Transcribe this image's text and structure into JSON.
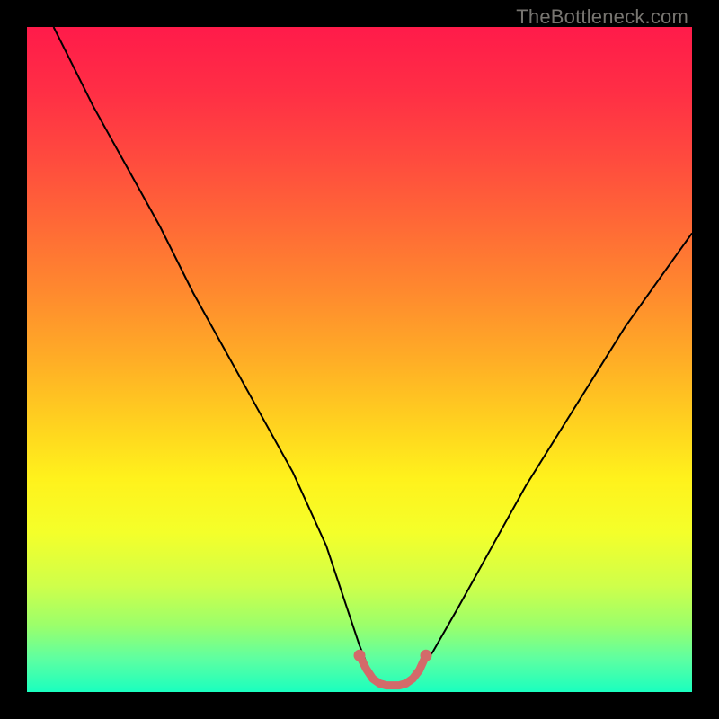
{
  "watermark": "TheBottleneck.com",
  "chart_data": {
    "type": "line",
    "title": "",
    "xlabel": "",
    "ylabel": "",
    "xlim": [
      0,
      100
    ],
    "ylim": [
      0,
      100
    ],
    "grid": false,
    "series": [
      {
        "name": "bottleneck-curve",
        "color": "#000000",
        "x": [
          4,
          10,
          15,
          20,
          25,
          30,
          35,
          40,
          45,
          48,
          50,
          52,
          54,
          56,
          58,
          61,
          65,
          70,
          75,
          80,
          85,
          90,
          95,
          100
        ],
        "y": [
          100,
          88,
          79,
          70,
          60,
          51,
          42,
          33,
          22,
          13,
          7,
          2,
          1,
          1,
          2,
          6,
          13,
          22,
          31,
          39,
          47,
          55,
          62,
          69
        ]
      },
      {
        "name": "optimal-segment",
        "color": "#d36a6a",
        "x": [
          50,
          51,
          52,
          53,
          54,
          55,
          56,
          57,
          58,
          59,
          60
        ],
        "y": [
          5.5,
          3.5,
          2.0,
          1.3,
          1.0,
          1.0,
          1.0,
          1.3,
          2.0,
          3.3,
          5.5
        ]
      }
    ],
    "gradient_stops": [
      {
        "offset": 0.0,
        "color": "#ff1b4a"
      },
      {
        "offset": 0.1,
        "color": "#ff2f45"
      },
      {
        "offset": 0.2,
        "color": "#ff4b3e"
      },
      {
        "offset": 0.3,
        "color": "#ff6a36"
      },
      {
        "offset": 0.4,
        "color": "#ff8a2e"
      },
      {
        "offset": 0.5,
        "color": "#ffad26"
      },
      {
        "offset": 0.6,
        "color": "#ffd31f"
      },
      {
        "offset": 0.68,
        "color": "#fff21c"
      },
      {
        "offset": 0.76,
        "color": "#f4ff2a"
      },
      {
        "offset": 0.84,
        "color": "#cfff4a"
      },
      {
        "offset": 0.9,
        "color": "#9bff6b"
      },
      {
        "offset": 0.95,
        "color": "#5effa1"
      },
      {
        "offset": 1.0,
        "color": "#1affbf"
      }
    ]
  }
}
